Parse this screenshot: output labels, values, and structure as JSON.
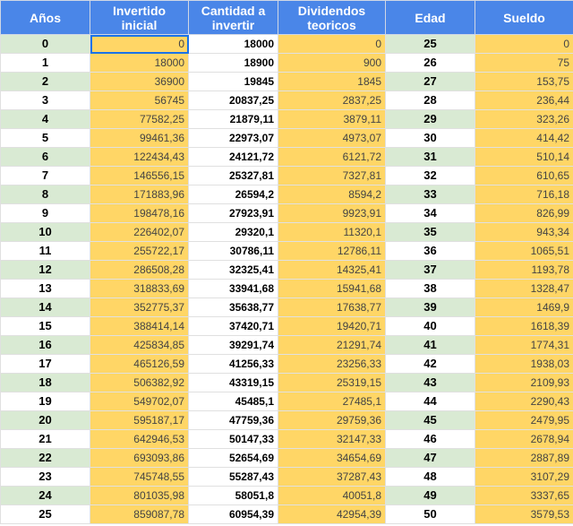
{
  "headers": {
    "years": "Años",
    "initial": "Invertido inicial",
    "amount": "Cantidad a invertir",
    "dividends": "Dividendos teoricos",
    "age": "Edad",
    "salary": "Sueldo"
  },
  "rows": [
    {
      "year": "0",
      "initial": "0",
      "amount": "18000",
      "dividends": "0",
      "age": "25",
      "salary": "0"
    },
    {
      "year": "1",
      "initial": "18000",
      "amount": "18900",
      "dividends": "900",
      "age": "26",
      "salary": "75"
    },
    {
      "year": "2",
      "initial": "36900",
      "amount": "19845",
      "dividends": "1845",
      "age": "27",
      "salary": "153,75"
    },
    {
      "year": "3",
      "initial": "56745",
      "amount": "20837,25",
      "dividends": "2837,25",
      "age": "28",
      "salary": "236,44"
    },
    {
      "year": "4",
      "initial": "77582,25",
      "amount": "21879,11",
      "dividends": "3879,11",
      "age": "29",
      "salary": "323,26"
    },
    {
      "year": "5",
      "initial": "99461,36",
      "amount": "22973,07",
      "dividends": "4973,07",
      "age": "30",
      "salary": "414,42"
    },
    {
      "year": "6",
      "initial": "122434,43",
      "amount": "24121,72",
      "dividends": "6121,72",
      "age": "31",
      "salary": "510,14"
    },
    {
      "year": "7",
      "initial": "146556,15",
      "amount": "25327,81",
      "dividends": "7327,81",
      "age": "32",
      "salary": "610,65"
    },
    {
      "year": "8",
      "initial": "171883,96",
      "amount": "26594,2",
      "dividends": "8594,2",
      "age": "33",
      "salary": "716,18"
    },
    {
      "year": "9",
      "initial": "198478,16",
      "amount": "27923,91",
      "dividends": "9923,91",
      "age": "34",
      "salary": "826,99"
    },
    {
      "year": "10",
      "initial": "226402,07",
      "amount": "29320,1",
      "dividends": "11320,1",
      "age": "35",
      "salary": "943,34"
    },
    {
      "year": "11",
      "initial": "255722,17",
      "amount": "30786,11",
      "dividends": "12786,11",
      "age": "36",
      "salary": "1065,51"
    },
    {
      "year": "12",
      "initial": "286508,28",
      "amount": "32325,41",
      "dividends": "14325,41",
      "age": "37",
      "salary": "1193,78"
    },
    {
      "year": "13",
      "initial": "318833,69",
      "amount": "33941,68",
      "dividends": "15941,68",
      "age": "38",
      "salary": "1328,47"
    },
    {
      "year": "14",
      "initial": "352775,37",
      "amount": "35638,77",
      "dividends": "17638,77",
      "age": "39",
      "salary": "1469,9"
    },
    {
      "year": "15",
      "initial": "388414,14",
      "amount": "37420,71",
      "dividends": "19420,71",
      "age": "40",
      "salary": "1618,39"
    },
    {
      "year": "16",
      "initial": "425834,85",
      "amount": "39291,74",
      "dividends": "21291,74",
      "age": "41",
      "salary": "1774,31"
    },
    {
      "year": "17",
      "initial": "465126,59",
      "amount": "41256,33",
      "dividends": "23256,33",
      "age": "42",
      "salary": "1938,03"
    },
    {
      "year": "18",
      "initial": "506382,92",
      "amount": "43319,15",
      "dividends": "25319,15",
      "age": "43",
      "salary": "2109,93"
    },
    {
      "year": "19",
      "initial": "549702,07",
      "amount": "45485,1",
      "dividends": "27485,1",
      "age": "44",
      "salary": "2290,43"
    },
    {
      "year": "20",
      "initial": "595187,17",
      "amount": "47759,36",
      "dividends": "29759,36",
      "age": "45",
      "salary": "2479,95"
    },
    {
      "year": "21",
      "initial": "642946,53",
      "amount": "50147,33",
      "dividends": "32147,33",
      "age": "46",
      "salary": "2678,94"
    },
    {
      "year": "22",
      "initial": "693093,86",
      "amount": "52654,69",
      "dividends": "34654,69",
      "age": "47",
      "salary": "2887,89"
    },
    {
      "year": "23",
      "initial": "745748,55",
      "amount": "55287,43",
      "dividends": "37287,43",
      "age": "48",
      "salary": "3107,29"
    },
    {
      "year": "24",
      "initial": "801035,98",
      "amount": "58051,8",
      "dividends": "40051,8",
      "age": "49",
      "salary": "3337,65"
    },
    {
      "year": "25",
      "initial": "859087,78",
      "amount": "60954,39",
      "dividends": "42954,39",
      "age": "50",
      "salary": "3579,53"
    }
  ],
  "colors": {
    "header_bg": "#4a86e8",
    "yellow_cell": "#ffd666",
    "green_cell": "#d9ead3",
    "selection": "#1a73e8"
  }
}
